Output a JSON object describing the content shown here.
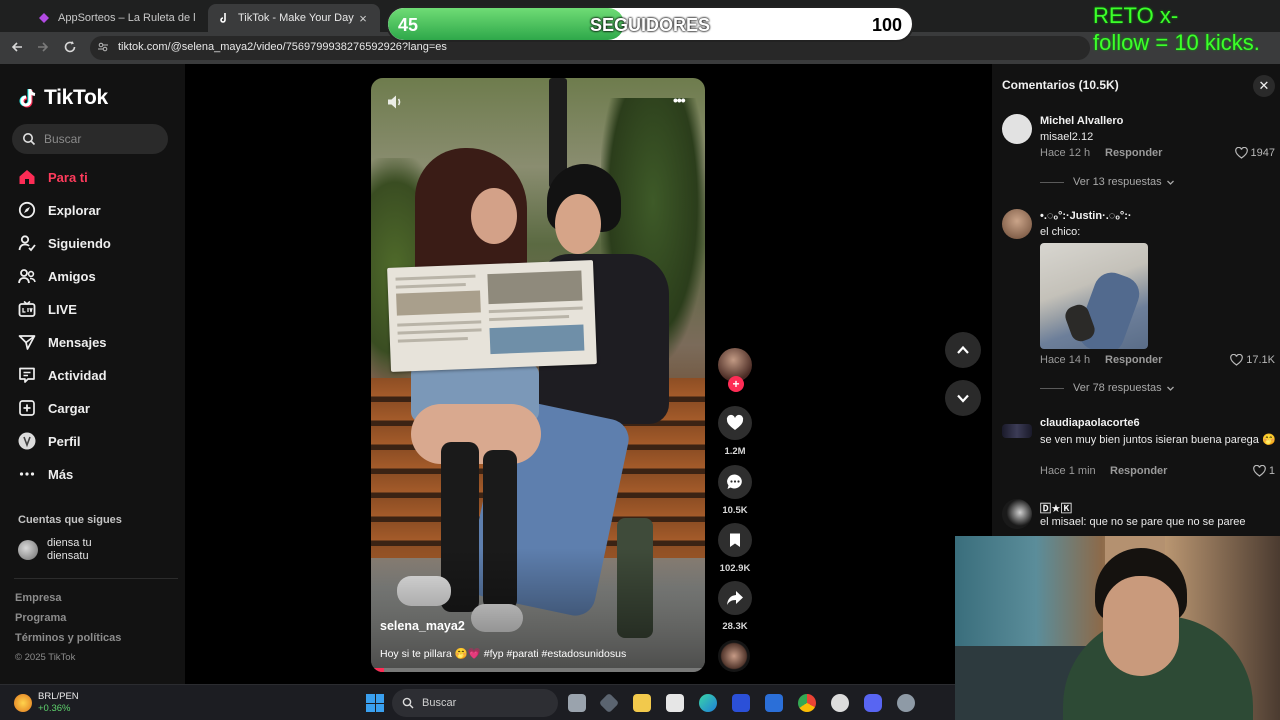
{
  "browser": {
    "tabs": [
      {
        "title": "AppSorteos – La Ruleta de la Su",
        "active": false
      },
      {
        "title": "TikTok - Make Your Day",
        "active": true
      }
    ],
    "url": "tiktok.com/@selena_maya2/video/7569799938276592926?lang=es"
  },
  "sidebar": {
    "logo": "TikTok",
    "search_placeholder": "Buscar",
    "nav": [
      {
        "label": "Para ti",
        "icon": "home-icon",
        "active": true
      },
      {
        "label": "Explorar",
        "icon": "compass-icon"
      },
      {
        "label": "Siguiendo",
        "icon": "following-icon"
      },
      {
        "label": "Amigos",
        "icon": "friends-icon"
      },
      {
        "label": "LIVE",
        "icon": "live-icon"
      },
      {
        "label": "Mensajes",
        "icon": "messages-icon"
      },
      {
        "label": "Actividad",
        "icon": "activity-icon"
      },
      {
        "label": "Cargar",
        "icon": "upload-icon"
      },
      {
        "label": "Perfil",
        "icon": "profile-icon"
      },
      {
        "label": "Más",
        "icon": "more-icon"
      }
    ],
    "following_title": "Cuentas que sigues",
    "following": [
      {
        "name": "diensa tu diensatu"
      }
    ],
    "footer_links": [
      "Empresa",
      "Programa",
      "Términos y políticas"
    ],
    "copyright": "© 2025 TikTok"
  },
  "video": {
    "author": "selena_maya2",
    "caption": "Hoy si te pillara 🤭💗 #fyp #parati #estadosunidosus",
    "progress": 0.04
  },
  "actions": {
    "likes": "1.2M",
    "comments": "10.5K",
    "saves": "102.9K",
    "shares": "28.3K"
  },
  "comments_panel": {
    "title": "Comentarios (10.5K)",
    "comments": [
      {
        "user": "Michel Alvallero",
        "text": "misael2.12",
        "time": "Hace 12 h",
        "reply": "Responder",
        "likes": "1947",
        "more": "Ver 13 respuestas"
      },
      {
        "user": "•.◌ₒ°:·Justin·.◌ₒ°:·",
        "text": "el chico:",
        "time": "Hace 14 h",
        "reply": "Responder",
        "likes": "17.1K",
        "more": "Ver 78 respuestas"
      },
      {
        "user": "claudiapaolacorte6",
        "text": "se ven muy bien juntos isieran buena parega 🤭",
        "time": "Hace 1 min",
        "reply": "Responder",
        "likes": "1"
      },
      {
        "user": "🄳★🄺",
        "text": "el misael: que no se pare que no se paree"
      }
    ]
  },
  "overlay": {
    "goal_current": "45",
    "goal_label": "SEGUIDORES",
    "goal_target": "100",
    "goal_progress": 0.45,
    "challenge_line1": "RETO  x-",
    "challenge_line2": "follow = 10 kicks."
  },
  "taskbar": {
    "ticker_name": "BRL/PEN",
    "ticker_change": "+0.36%",
    "search_placeholder": "Buscar"
  },
  "colors": {
    "accent": "#fe2c55",
    "goal_green": "#2ea84a",
    "challenge_text": "#3dff2a"
  }
}
